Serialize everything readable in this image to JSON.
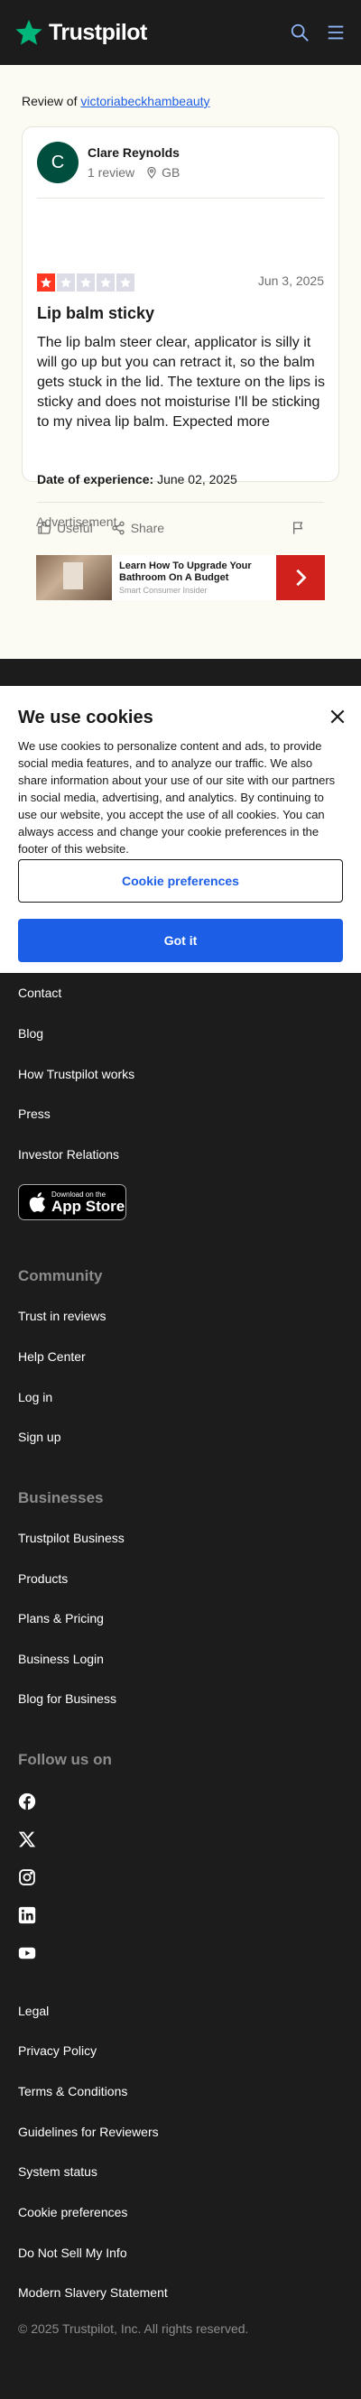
{
  "header": {
    "brand": "Trustpilot",
    "icons": [
      "search-icon",
      "menu-icon"
    ],
    "brand_color": "#00b67a"
  },
  "review_of": {
    "prefix": "Review of",
    "company": "victoriabeckhambeauty"
  },
  "review": {
    "consumer_initial": "C",
    "consumer_name": "Clare Reynolds",
    "review_count": "1 review",
    "country": "GB",
    "rating": 1,
    "rating_max": 5,
    "date": "Jun 3, 2025",
    "title": "Lip balm sticky",
    "text": "The lip balm steer clear, applicator is silly it will go up but you can retract it, so the balm gets stuck in the lid. The texture on the lips is sticky and does not moisturise I'll be sticking to my nivea lip balm.",
    "expand": "Expected more",
    "doe_label": "Date of experience:",
    "doe_value": "June 02, 2025",
    "useful_label": "Useful",
    "share_label": "Share",
    "star_color": "#ff3722"
  },
  "advertisement": {
    "label": "Advertisement",
    "title": "Learn How To Upgrade Your Bathroom On A Budget",
    "sponsor": "Smart Consumer Insider"
  },
  "cookies": {
    "title": "We use cookies",
    "text": "We use cookies to personalize content and ads, to provide social media features, and to analyze our traffic. We also share information about your use of our site with our partners in social media, advertising, and analytics. By continuing to use our website, you accept the use of all cookies. You can always access and change your cookie preferences in the footer of this website.",
    "preferences_label": "Cookie preferences",
    "accept_label": "Got it",
    "accent": "#1c5ee6"
  },
  "footer": {
    "about_links": [
      "Contact",
      "Blog",
      "How Trustpilot works",
      "Press",
      "Investor Relations"
    ],
    "app_store_small": "Download on the",
    "app_store_big": "App Store",
    "community_heading": "Community",
    "community_links": [
      "Trust in reviews",
      "Help Center",
      "Log in",
      "Sign up"
    ],
    "businesses_heading": "Businesses",
    "businesses_links": [
      "Trustpilot Business",
      "Products",
      "Plans & Pricing",
      "Business Login",
      "Blog for Business"
    ],
    "follow_heading": "Follow us on",
    "social_icons": [
      "facebook-icon",
      "x-icon",
      "instagram-icon",
      "linkedin-icon",
      "youtube-icon"
    ],
    "legal_links": [
      "Legal",
      "Privacy Policy",
      "Terms & Conditions",
      "Guidelines for Reviewers",
      "System status",
      "Cookie preferences",
      "Do Not Sell My Info",
      "Modern Slavery Statement"
    ],
    "copyright": "© 2025 Trustpilot, Inc. All rights reserved."
  }
}
